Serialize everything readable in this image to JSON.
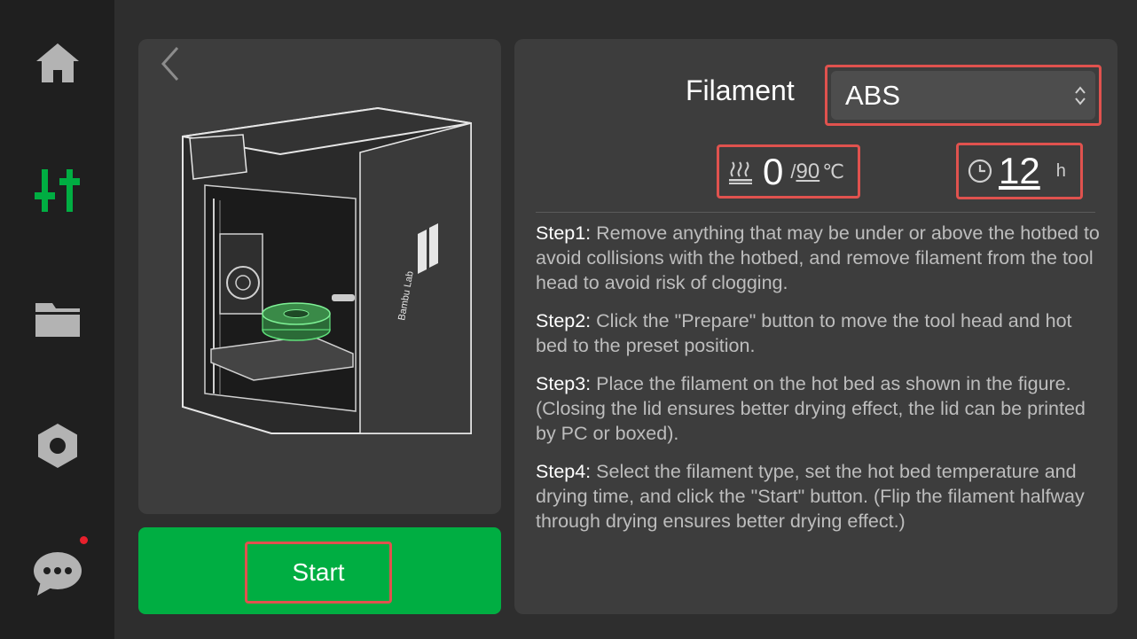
{
  "sidebar": {
    "items": [
      {
        "icon": "home-icon",
        "color": "#b3b3b3"
      },
      {
        "icon": "sliders-icon",
        "color": "#00ae42",
        "active": true
      },
      {
        "icon": "folder-icon",
        "color": "#b3b3b3"
      },
      {
        "icon": "hex-nut-settings-icon",
        "color": "#b3b3b3"
      },
      {
        "icon": "chat-bubble-icon",
        "color": "#b3b3b3",
        "notification": true
      }
    ]
  },
  "back_icon": "chevron-left-icon",
  "illustration": {
    "brand_text": "Bambu Lab"
  },
  "start_button": {
    "label": "Start",
    "color": "#00ae42"
  },
  "filament": {
    "label": "Filament",
    "value": "ABS"
  },
  "temperature": {
    "current": "0",
    "separator": "/",
    "target": "90",
    "unit": "℃"
  },
  "drying_time": {
    "value": "12",
    "unit": "h"
  },
  "steps": [
    {
      "title": "Step1:",
      "text": "Remove anything that may be under or above the hotbed to avoid collisions with the hotbed, and remove filament from the tool head to avoid risk of clogging."
    },
    {
      "title": "Step2:",
      "text": "Click the \"Prepare\" button to move the tool head and hot bed to the preset position."
    },
    {
      "title": "Step3:",
      "text": "Place the filament on the hot bed as shown in the figure. (Closing the lid ensures better drying effect, the lid can be printed by PC or boxed)."
    },
    {
      "title": "Step4:",
      "text": "Select the filament type, set the hot bed temperature and drying time, and click the \"Start\" button. (Flip the filament halfway through drying ensures better drying effect.)"
    }
  ],
  "colors": {
    "accent": "#00ae42",
    "highlight_border": "#e0524e",
    "panel": "#3d3d3d",
    "sidebar": "#1f1f1f",
    "notification": "#e8202c"
  }
}
